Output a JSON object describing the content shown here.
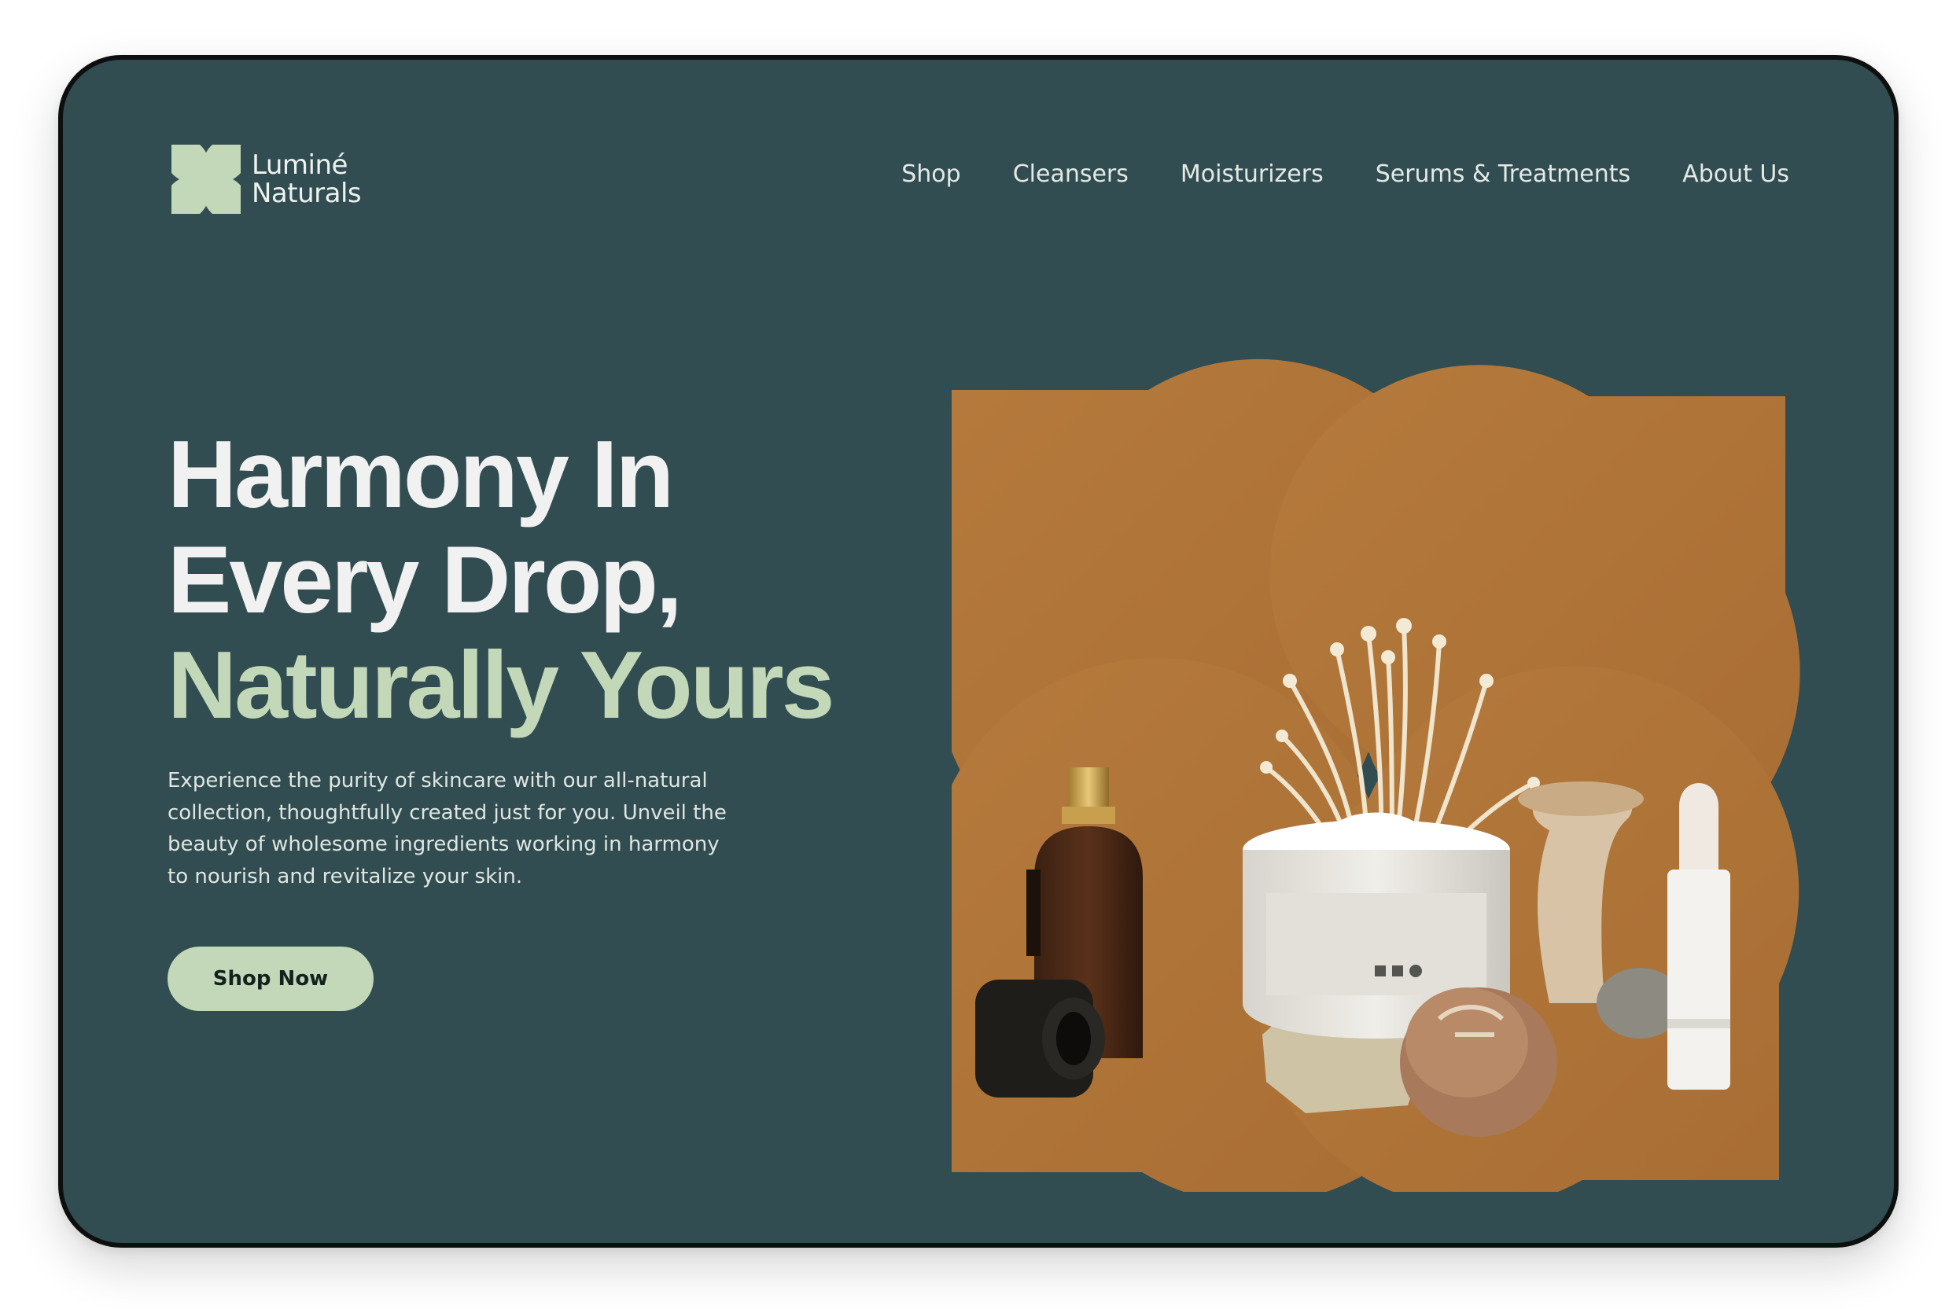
{
  "brand": {
    "name_line1": "Luminé",
    "name_line2": "Naturals",
    "logo_icon": "four-petal-leaf-icon",
    "accent_color": "#c3d8b8",
    "background_color": "#314d51"
  },
  "nav": {
    "items": [
      {
        "label": "Shop"
      },
      {
        "label": "Cleansers"
      },
      {
        "label": "Moisturizers"
      },
      {
        "label": "Serums & Treatments"
      },
      {
        "label": "About Us"
      }
    ]
  },
  "hero": {
    "headline_line1": "Harmony In",
    "headline_line2": "Every Drop,",
    "headline_line3": "Naturally Yours",
    "description": "Experience the purity of skincare with our all-natural collection, thoughtfully created just for you. Unveil the beauty of wholesome ingredients working in harmony to nourish and revitalize your skin.",
    "cta_label": "Shop Now",
    "image_subject": "skincare products with mushrooms on terracotta background in four-petal frame",
    "image_color": "#b27a3d"
  }
}
